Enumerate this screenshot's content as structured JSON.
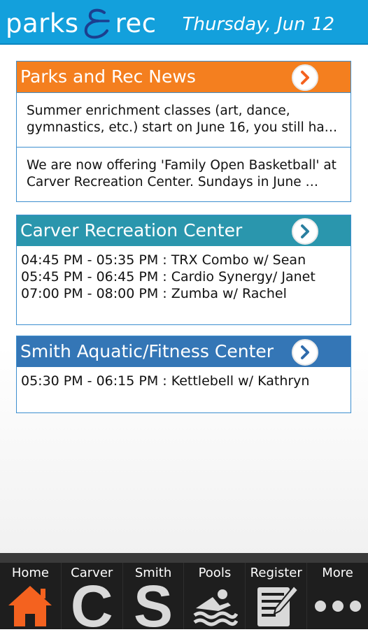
{
  "header": {
    "logo_left": "parks",
    "logo_right": "rec",
    "date": "Thursday, Jun 12"
  },
  "news": {
    "title": "Parks and Rec News",
    "color": "#f47f1f",
    "items": [
      {
        "line1": "Summer enrichment classes (art, dance,",
        "line2": "gymnastics, etc.) start on June 16, you still hav…"
      },
      {
        "line1": "We are now offering 'Family Open Basketball' at",
        "line2": "Carver Recreation Center.       Sundays in June …"
      }
    ]
  },
  "carver": {
    "title": "Carver Recreation Center",
    "color": "#2a96ad",
    "classes": [
      "04:45 PM - 05:35 PM : TRX Combo w/ Sean",
      "05:45 PM - 06:45 PM : Cardio Synergy/ Janet",
      "07:00 PM - 08:00 PM : Zumba w/ Rachel"
    ]
  },
  "smith": {
    "title": "Smith Aquatic/Fitness Center",
    "color": "#3476b6",
    "classes": [
      "05:30 PM - 06:15 PM : Kettlebell w/ Kathryn"
    ]
  },
  "nav": [
    {
      "label": "Home",
      "icon": "home-icon",
      "active_color": "#f4621f"
    },
    {
      "label": "Carver",
      "icon": "C"
    },
    {
      "label": "Smith",
      "icon": "S"
    },
    {
      "label": "Pools",
      "icon": "swimmer-icon"
    },
    {
      "label": "Register",
      "icon": "register-icon"
    },
    {
      "label": "More",
      "icon": "more-icon"
    }
  ]
}
